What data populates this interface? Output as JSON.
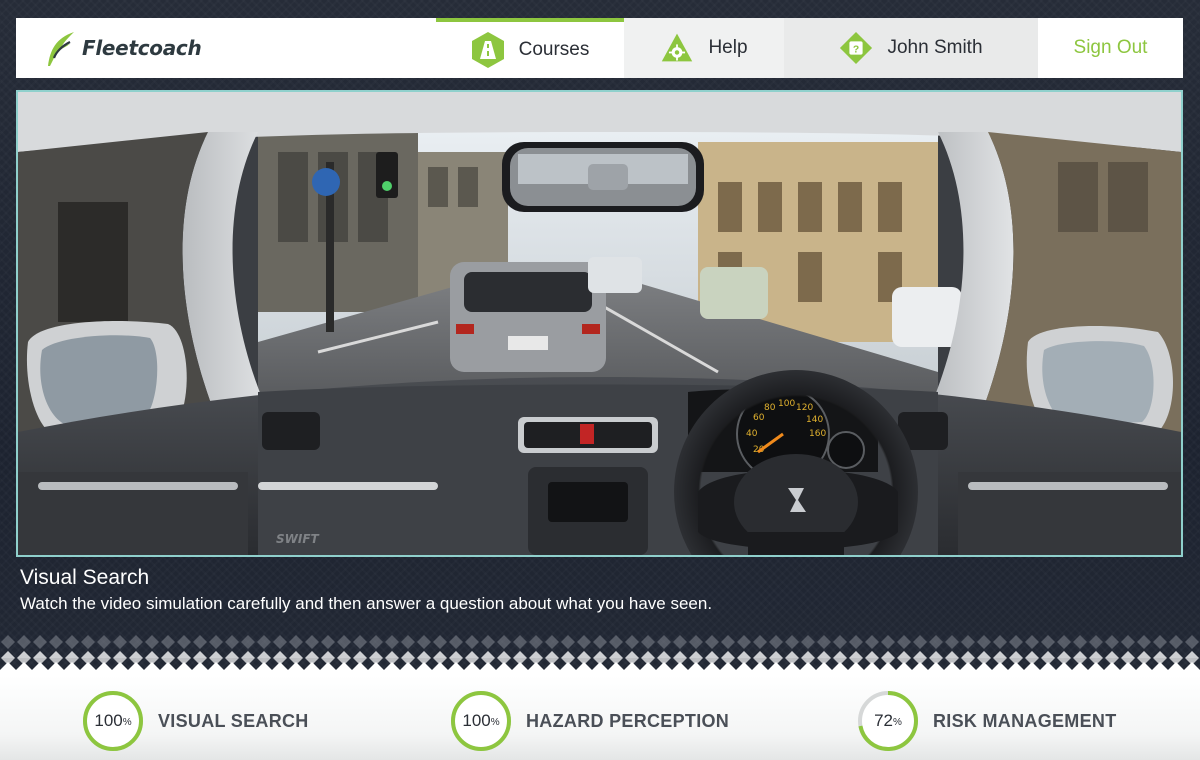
{
  "header": {
    "logo_text": "Fleetcoach",
    "nav": {
      "courses_label": "Courses",
      "help_label": "Help",
      "user_name": "John Smith",
      "sign_out_label": "Sign Out"
    }
  },
  "video": {
    "car_badge": "SWIFT"
  },
  "caption": {
    "title": "Visual Search",
    "text": "Watch the video simulation carefully and then answer a question about what you have seen."
  },
  "progress": [
    {
      "value": 100,
      "label": "100",
      "unit": "%",
      "name": "VISUAL SEARCH"
    },
    {
      "value": 100,
      "label": "100",
      "unit": "%",
      "name": "HAZARD PERCEPTION"
    },
    {
      "value": 72,
      "label": "72",
      "unit": "%",
      "name": "RISK MANAGEMENT"
    }
  ],
  "colors": {
    "accent": "#8dc63f",
    "page_bg": "#1f2532",
    "video_border": "#8fd0cc",
    "ring_track": "#d6d8d8"
  },
  "icons": {
    "courses": "road-icon",
    "help": "gear-icon",
    "user": "question-badge-icon"
  }
}
